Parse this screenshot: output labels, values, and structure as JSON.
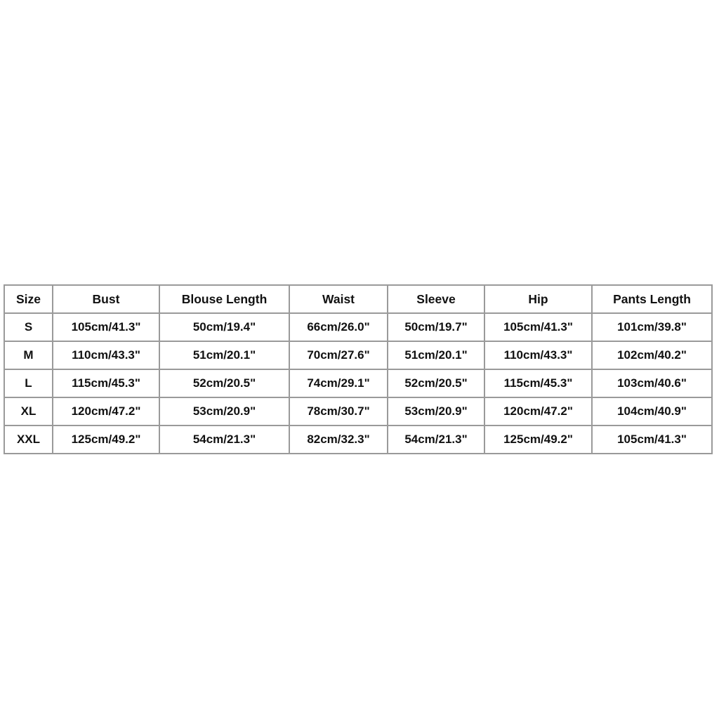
{
  "table": {
    "headers": [
      "Size",
      "Bust",
      "Blouse Length",
      "Waist",
      "Sleeve",
      "Hip",
      "Pants Length"
    ],
    "rows": [
      [
        "S",
        "105cm/41.3\"",
        "50cm/19.4\"",
        "66cm/26.0\"",
        "50cm/19.7\"",
        "105cm/41.3\"",
        "101cm/39.8\""
      ],
      [
        "M",
        "110cm/43.3\"",
        "51cm/20.1\"",
        "70cm/27.6\"",
        "51cm/20.1\"",
        "110cm/43.3\"",
        "102cm/40.2\""
      ],
      [
        "L",
        "115cm/45.3\"",
        "52cm/20.5\"",
        "74cm/29.1\"",
        "52cm/20.5\"",
        "115cm/45.3\"",
        "103cm/40.6\""
      ],
      [
        "XL",
        "120cm/47.2\"",
        "53cm/20.9\"",
        "78cm/30.7\"",
        "53cm/20.9\"",
        "120cm/47.2\"",
        "104cm/40.9\""
      ],
      [
        "XXL",
        "125cm/49.2\"",
        "54cm/21.3\"",
        "82cm/32.3\"",
        "54cm/21.3\"",
        "125cm/49.2\"",
        "105cm/41.3\""
      ]
    ]
  }
}
